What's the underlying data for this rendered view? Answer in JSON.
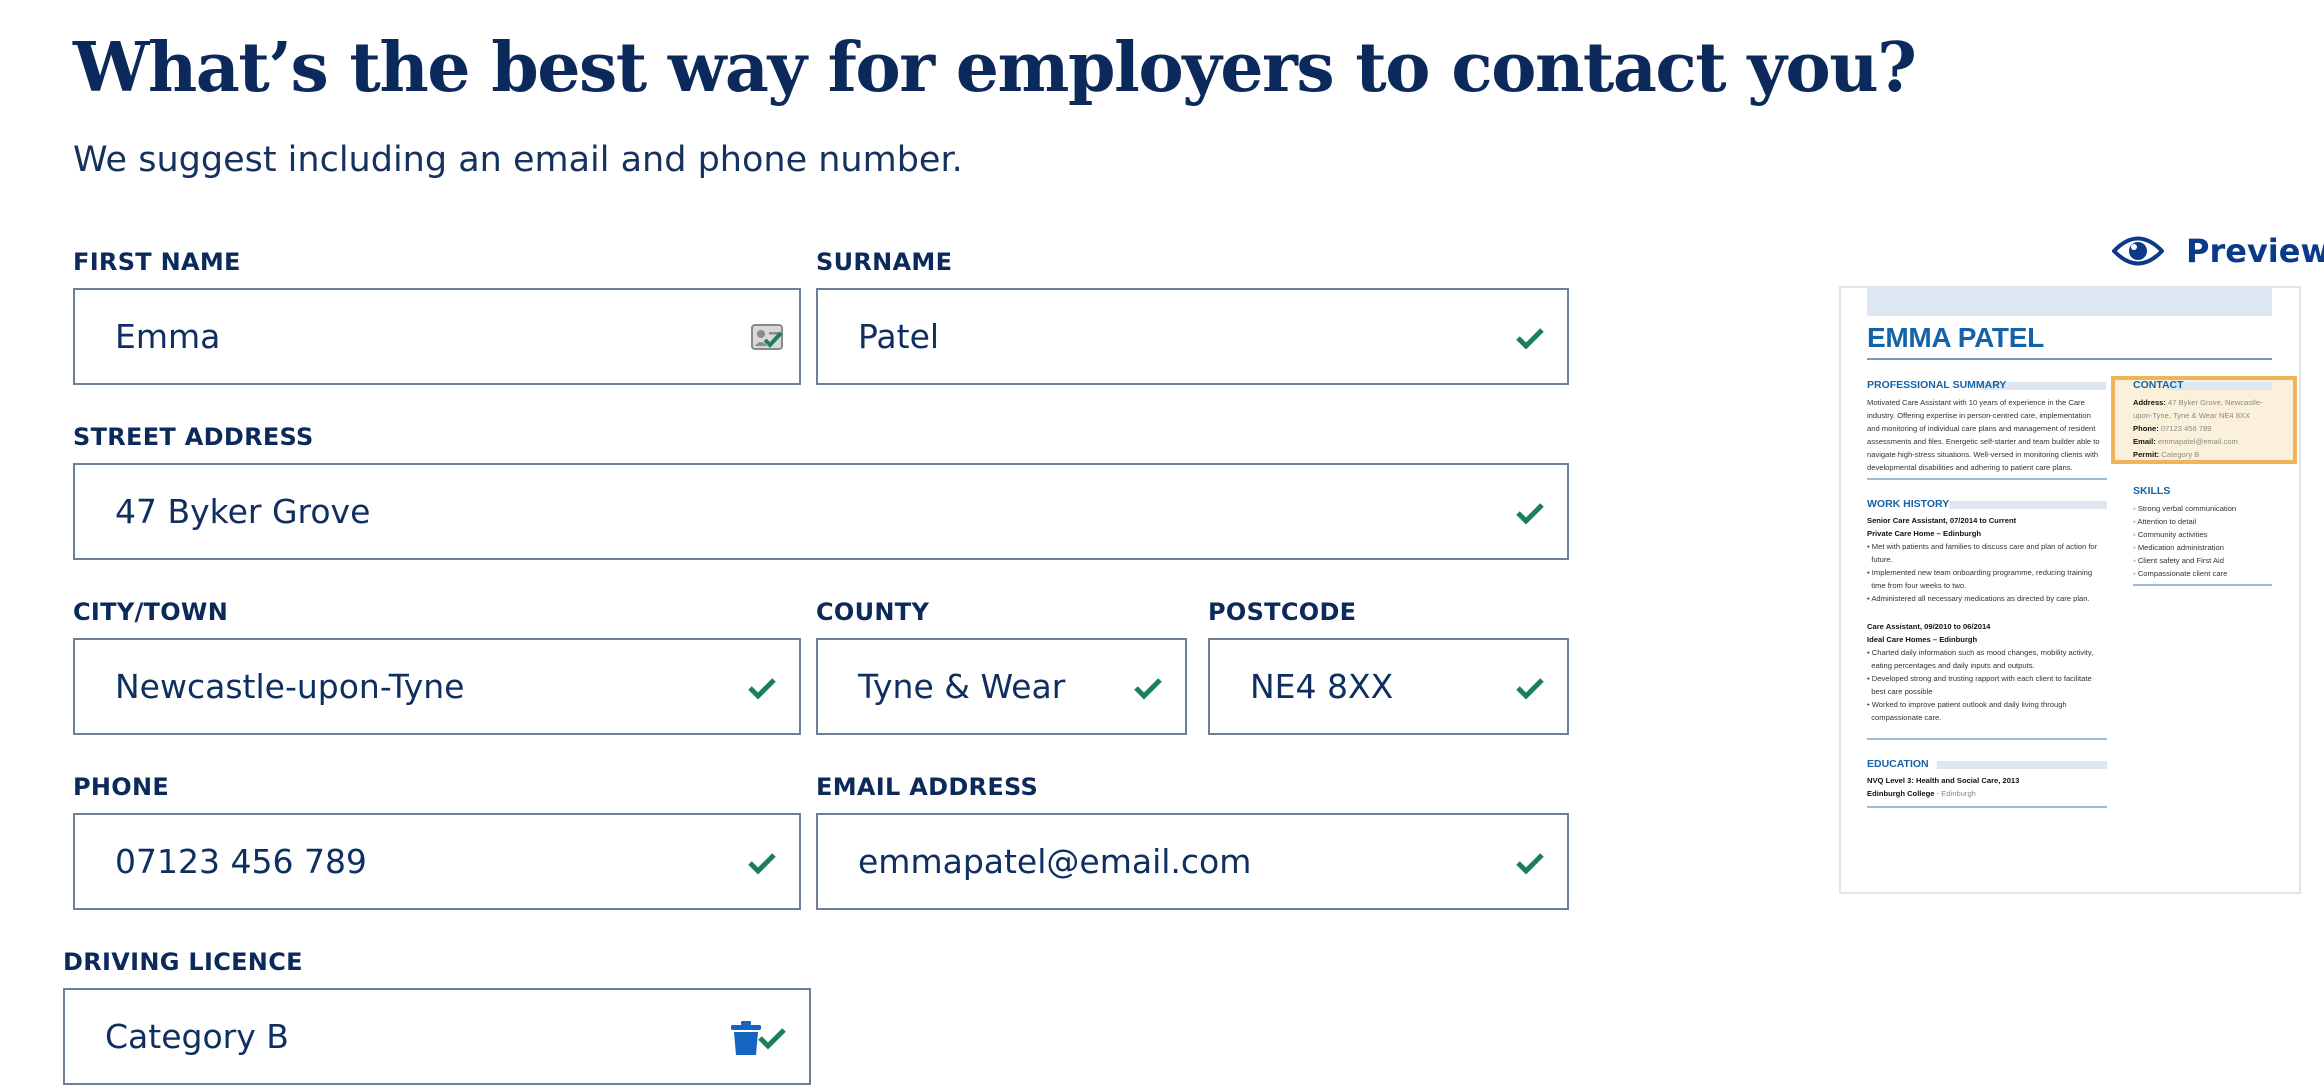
{
  "page": {
    "title": "What’s the best way for employers to contact you?",
    "subtitle": "We suggest including an email and phone number."
  },
  "form": {
    "first_name": {
      "label": "FIRST NAME",
      "value": "Emma"
    },
    "surname": {
      "label": "SURNAME",
      "value": "Patel"
    },
    "street": {
      "label": "STREET ADDRESS",
      "value": "47 Byker Grove"
    },
    "city": {
      "label": "CITY/TOWN",
      "value": "Newcastle-upon-Tyne"
    },
    "county": {
      "label": "COUNTY",
      "value": "Tyne & Wear"
    },
    "postcode": {
      "label": "POSTCODE",
      "value": "NE4 8XX"
    },
    "phone": {
      "label": "PHONE",
      "value": "07123 456 789"
    },
    "email": {
      "label": "EMAIL ADDRESS",
      "value": "emmapatel@email.com"
    },
    "licence": {
      "label": "DRIVING LICENCE",
      "value": "Category B"
    }
  },
  "preview": {
    "button_label": "Preview",
    "resume": {
      "name": "EMMA PATEL",
      "summary_heading": "PROFESSIONAL SUMMARY",
      "summary_lines": [
        "Motivated Care Assistant with 10 years of experience in the Care",
        "industry. Offering expertise in person-centred care, implementation",
        "and monitoring of individual care plans and management of resident",
        "assessments and files. Energetic self-starter and team builder able to",
        "navigate high-stress situations. Well-versed in monitoring clients with",
        "developmental disabilities and adhering to patient care plans."
      ],
      "contact_heading": "CONTACT",
      "contact": {
        "address_label": "Address:",
        "address_line1": "47 Byker Grove, Newcastle-",
        "address_line2": "upon-Tyne, Tyne & Wear NE4 8XX",
        "phone_label": "Phone:",
        "phone": "07123 456 789",
        "email_label": "Email:",
        "email": "emmapatel@email.com",
        "permit_label": "Permit:",
        "permit": "Category B"
      },
      "skills_heading": "SKILLS",
      "skills": [
        "Strong verbal communication",
        "Attention to detail",
        "Community activities",
        "Medication administration",
        "Client safety and First Aid",
        "Compassionate client care"
      ],
      "work_heading": "WORK HISTORY",
      "job1_title": "Senior Care Assistant, 07/2014 to Current",
      "job1_company": "Private Care Home",
      "job1_location": "Edinburgh",
      "job1_bullets": [
        "Met with patients and families to discuss care and plan of action for",
        "future.",
        "Implemented new team onboarding programme, reducing training",
        "time from four weeks to two.",
        "Administered all necessary medications as directed by care plan."
      ],
      "job2_title": "Care Assistant, 09/2010 to 06/2014",
      "job2_company": "Ideal Care Homes",
      "job2_location": "Edinburgh",
      "job2_bullets": [
        "Charted daily information such as mood changes, mobility activity,",
        "eating percentages and daily inputs and outputs.",
        "Developed strong and trusting rapport with each client to facilitate",
        "best care possible",
        "Worked to improve patient outlook and daily living through",
        "compassionate care."
      ],
      "education_heading": "EDUCATION",
      "edu_line1": "NVQ Level 3: Health and Social Care, 2013",
      "edu_school": "Edinburgh College",
      "edu_location": "Edinburgh"
    }
  },
  "colors": {
    "navy": "#0b2a5b",
    "check_green": "#1a7f5a",
    "trash_blue": "#1565c0",
    "highlight": "#f0b45c"
  }
}
